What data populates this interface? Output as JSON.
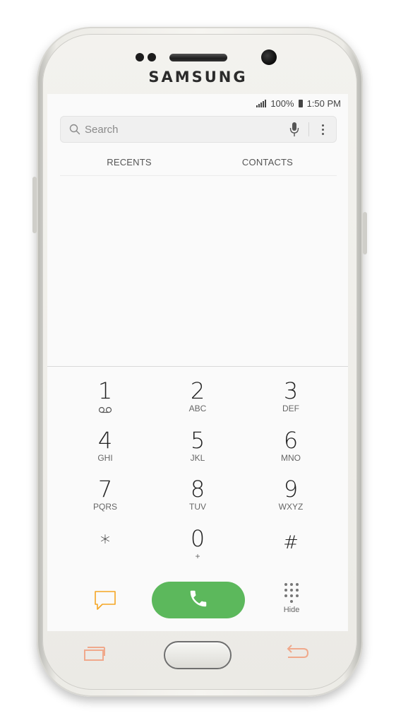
{
  "device": {
    "brand": "SAMSUNG"
  },
  "status_bar": {
    "battery": "100%",
    "time": "1:50 PM"
  },
  "search": {
    "placeholder": "Search"
  },
  "tabs": [
    {
      "label": "RECENTS"
    },
    {
      "label": "CONTACTS"
    }
  ],
  "keypad": {
    "keys": [
      {
        "digit": "1",
        "letters": "",
        "icon": "voicemail-icon"
      },
      {
        "digit": "2",
        "letters": "ABC"
      },
      {
        "digit": "3",
        "letters": "DEF"
      },
      {
        "digit": "4",
        "letters": "GHI"
      },
      {
        "digit": "5",
        "letters": "JKL"
      },
      {
        "digit": "6",
        "letters": "MNO"
      },
      {
        "digit": "7",
        "letters": "PQRS"
      },
      {
        "digit": "8",
        "letters": "TUV"
      },
      {
        "digit": "9",
        "letters": "WXYZ"
      },
      {
        "digit": "*",
        "letters": ""
      },
      {
        "digit": "0",
        "letters": "+"
      },
      {
        "digit": "#",
        "letters": ""
      }
    ]
  },
  "actions": {
    "message_icon": "message-icon",
    "call_icon": "phone-icon",
    "hide_label": "Hide"
  },
  "colors": {
    "call_button": "#5cb85c",
    "message_icon": "#f5a623",
    "nav_keys": "#f0a98c"
  }
}
